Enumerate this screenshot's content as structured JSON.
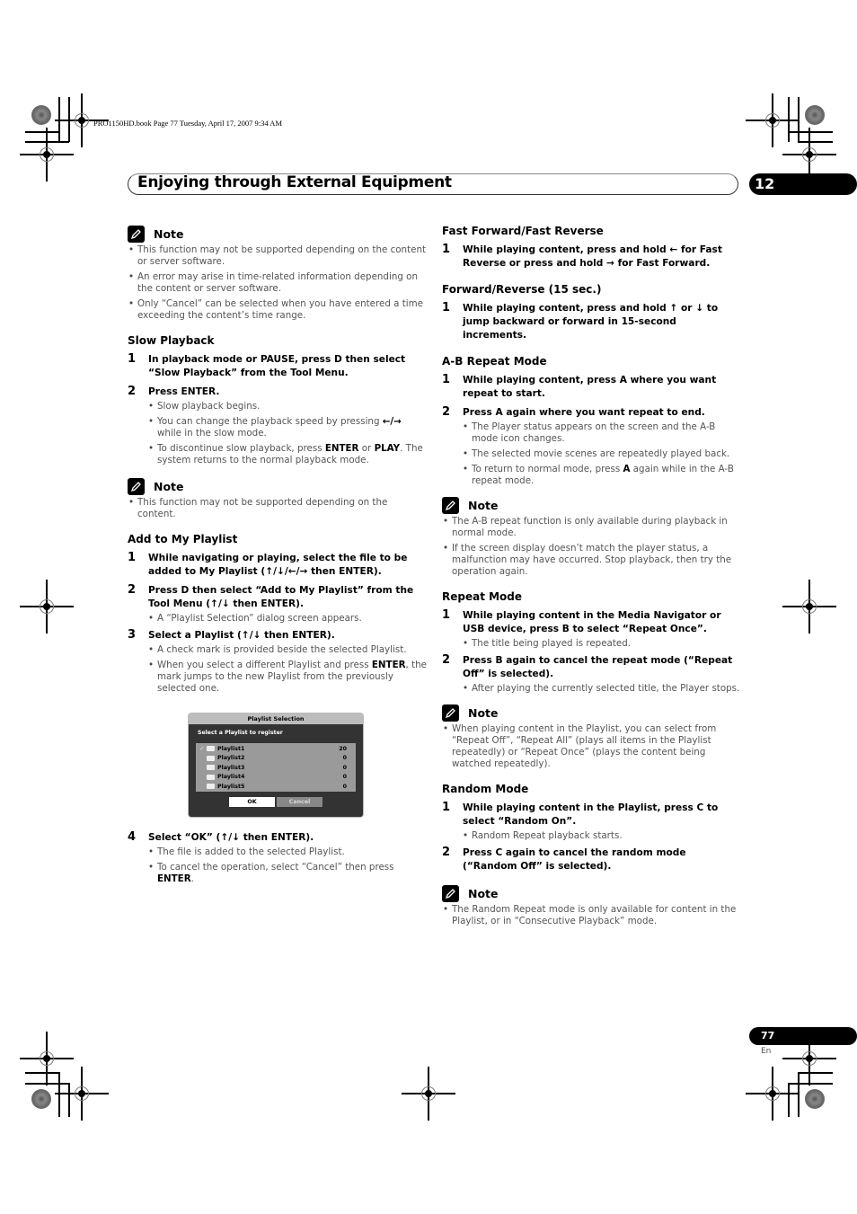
{
  "print_info": "PRO1150HD.book  Page 77  Tuesday, April 17, 2007  9:34 AM",
  "header": {
    "chapter_title": "Enjoying through External Equipment",
    "chapter_number": "12"
  },
  "footer": {
    "page_number": "77",
    "language": "En"
  },
  "icons": {
    "note": "pencil-note-icon",
    "up": "↑",
    "down": "↓",
    "left": "←",
    "right": "→"
  },
  "left_column": {
    "note1": {
      "label": "Note",
      "items": [
        "This function may not be supported depending on the content or server software.",
        "An error may arise in time-related information depending on the content or server software.",
        "Only “Cancel” can be selected when you have entered a time exceeding the content’s time range."
      ]
    },
    "slow_playback": {
      "title": "Slow Playback",
      "steps": [
        {
          "num": "1",
          "text": "In playback mode or PAUSE, press D then select “Slow Playback” from the Tool Menu."
        },
        {
          "num": "2",
          "text": "Press ENTER."
        }
      ],
      "step2_bullets": {
        "b1": "Slow playback begins.",
        "b2_pre": "You can change the playback speed by pressing ",
        "b2_post": " while in the slow mode.",
        "b3_pre": "To discontinue slow playback, press ",
        "b3_enter": "ENTER",
        "b3_mid": " or ",
        "b3_play": "PLAY",
        "b3_post": ". The system returns to the normal playback mode."
      }
    },
    "note2": {
      "label": "Note",
      "items": [
        "This function may not be supported depending on the content."
      ]
    },
    "add_playlist": {
      "title": "Add to My Playlist",
      "step1": {
        "num": "1",
        "pre": "While navigating or playing, select the file to be added to My Playlist (",
        "post": " then ENTER)."
      },
      "step2": {
        "num": "2",
        "pre": "Press D then select “Add to My Playlist” from the Tool Menu (",
        "post": " then ENTER).",
        "bullet": "A “Playlist Selection” dialog screen appears."
      },
      "step3": {
        "num": "3",
        "pre": "Select a Playlist (",
        "post": " then ENTER).",
        "b1": "A check mark is provided beside the selected Playlist.",
        "b2_pre": "When you select a different Playlist and press ",
        "b2_enter": "ENTER",
        "b2_post": ", the mark jumps to the new Playlist from the previously selected one."
      },
      "step4": {
        "num": "4",
        "pre": "Select “OK” (",
        "post": " then ENTER).",
        "b1": "The file is added to the selected Playlist.",
        "b2_pre": "To cancel the operation, select “Cancel” then press ",
        "b2_enter": "ENTER",
        "b2_post": "."
      }
    },
    "dialog": {
      "title": "Playlist Selection",
      "prompt": "Select a Playlist to register",
      "rows": [
        {
          "name": "Playlist1",
          "count": "20",
          "checked": true
        },
        {
          "name": "Playlist2",
          "count": "0",
          "checked": false
        },
        {
          "name": "Playlist3",
          "count": "0",
          "checked": false
        },
        {
          "name": "Playlist4",
          "count": "0",
          "checked": false
        },
        {
          "name": "Playlist5",
          "count": "0",
          "checked": false
        }
      ],
      "ok_label": "OK",
      "cancel_label": "Cancel"
    }
  },
  "right_column": {
    "ff_fr": {
      "title": "Fast Forward/Fast Reverse",
      "step1": {
        "num": "1",
        "a": "While playing content, press and hold ",
        "b": " for Fast Reverse or press and hold ",
        "c": " for Fast Forward."
      }
    },
    "fwd_rev": {
      "title": "Forward/Reverse (15 sec.)",
      "step1": {
        "num": "1",
        "a": "While playing content, press and hold ",
        "b": " or ",
        "c": " to jump backward or forward in 15-second increments."
      }
    },
    "ab_repeat": {
      "title": "A-B Repeat Mode",
      "step1": {
        "num": "1",
        "text": "While playing content, press A where you want repeat to start."
      },
      "step2": {
        "num": "2",
        "text": "Press A again where you want repeat to end."
      },
      "b1": "The Player status appears on the screen and the A-B mode icon changes.",
      "b2": "The selected movie scenes are repeatedly played back.",
      "b3_pre": "To return to normal mode, press ",
      "b3_a": "A",
      "b3_post": " again while in the A-B repeat mode."
    },
    "note3": {
      "label": "Note",
      "items": [
        "The A-B repeat function is only available during playback in normal mode.",
        "If the screen display doesn’t match the player status, a malfunction may have occurred. Stop playback, then try the operation again."
      ]
    },
    "repeat_mode": {
      "title": "Repeat Mode",
      "step1": {
        "num": "1",
        "text": "While playing content in the Media Navigator or USB device, press B to select “Repeat Once”.",
        "bullet": "The title being played is repeated."
      },
      "step2": {
        "num": "2",
        "text": "Press B again to cancel the repeat mode (“Repeat Off” is selected).",
        "bullet": "After playing the currently selected title, the Player stops."
      }
    },
    "note4": {
      "label": "Note",
      "items": [
        "When playing content in the Playlist, you can select from “Repeat Off”,  “Repeat All” (plays all items in the Playlist repeatedly) or “Repeat Once” (plays the content being watched repeatedly)."
      ]
    },
    "random_mode": {
      "title": "Random Mode",
      "step1": {
        "num": "1",
        "text": "While playing content in the Playlist, press C to select “Random On”.",
        "bullet": "Random Repeat playback starts."
      },
      "step2": {
        "num": "2",
        "text": "Press C again to cancel the random mode (“Random Off” is selected)."
      }
    },
    "note5": {
      "label": "Note",
      "items": [
        "The Random Repeat mode is only available for content in the Playlist, or in “Consecutive Playback” mode."
      ]
    }
  }
}
